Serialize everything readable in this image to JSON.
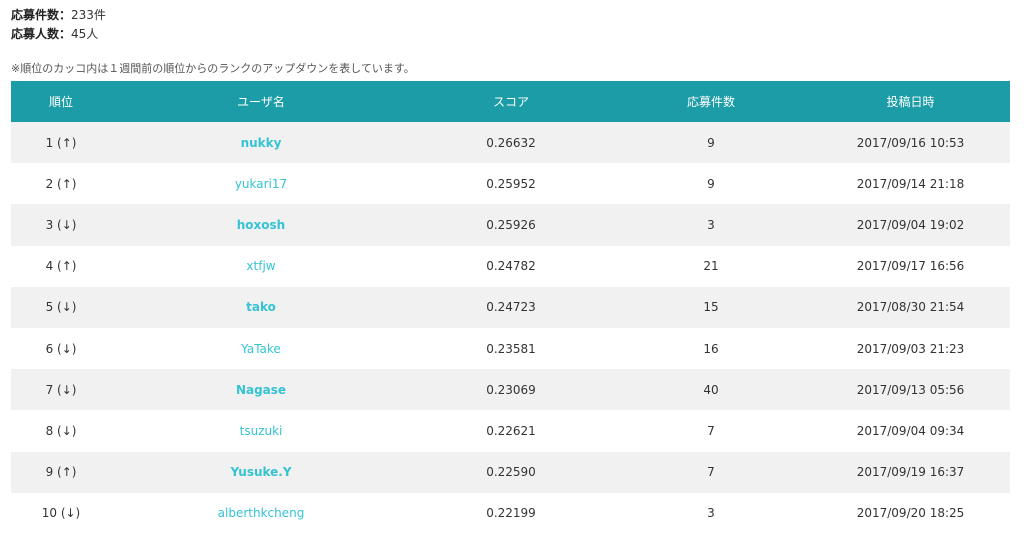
{
  "summary": {
    "entries_label": "応募件数：",
    "entries_value": "233件",
    "people_label": "応募人数：",
    "people_value": "45人"
  },
  "note": "※順位のカッコ内は１週間前の順位からのランクのアップダウンを表しています。",
  "table": {
    "headers": [
      "順位",
      "ユーザ名",
      "スコア",
      "応募件数",
      "投稿日時"
    ],
    "rows": [
      {
        "rank": "1 (↑)",
        "user": "nukky",
        "score": "0.26632",
        "count": "9",
        "date": "2017/09/16 10:53"
      },
      {
        "rank": "2 (↑)",
        "user": "yukari17",
        "score": "0.25952",
        "count": "9",
        "date": "2017/09/14 21:18"
      },
      {
        "rank": "3 (↓)",
        "user": "hoxosh",
        "score": "0.25926",
        "count": "3",
        "date": "2017/09/04 19:02"
      },
      {
        "rank": "4 (↑)",
        "user": "xtfjw",
        "score": "0.24782",
        "count": "21",
        "date": "2017/09/17 16:56"
      },
      {
        "rank": "5 (↓)",
        "user": "tako",
        "score": "0.24723",
        "count": "15",
        "date": "2017/08/30 21:54"
      },
      {
        "rank": "6 (↓)",
        "user": "YaTake",
        "score": "0.23581",
        "count": "16",
        "date": "2017/09/03 21:23"
      },
      {
        "rank": "7 (↓)",
        "user": "Nagase",
        "score": "0.23069",
        "count": "40",
        "date": "2017/09/13 05:56"
      },
      {
        "rank": "8 (↓)",
        "user": "tsuzuki",
        "score": "0.22621",
        "count": "7",
        "date": "2017/09/04 09:34"
      },
      {
        "rank": "9 (↑)",
        "user": "Yusuke.Y",
        "score": "0.22590",
        "count": "7",
        "date": "2017/09/19 16:37"
      },
      {
        "rank": "10 (↓)",
        "user": "alberthkcheng",
        "score": "0.22199",
        "count": "3",
        "date": "2017/09/20 18:25"
      }
    ]
  },
  "colors": {
    "header_bg": "#1c9ca6",
    "link": "#35c3d3",
    "stripe": "#f1f1f1"
  }
}
